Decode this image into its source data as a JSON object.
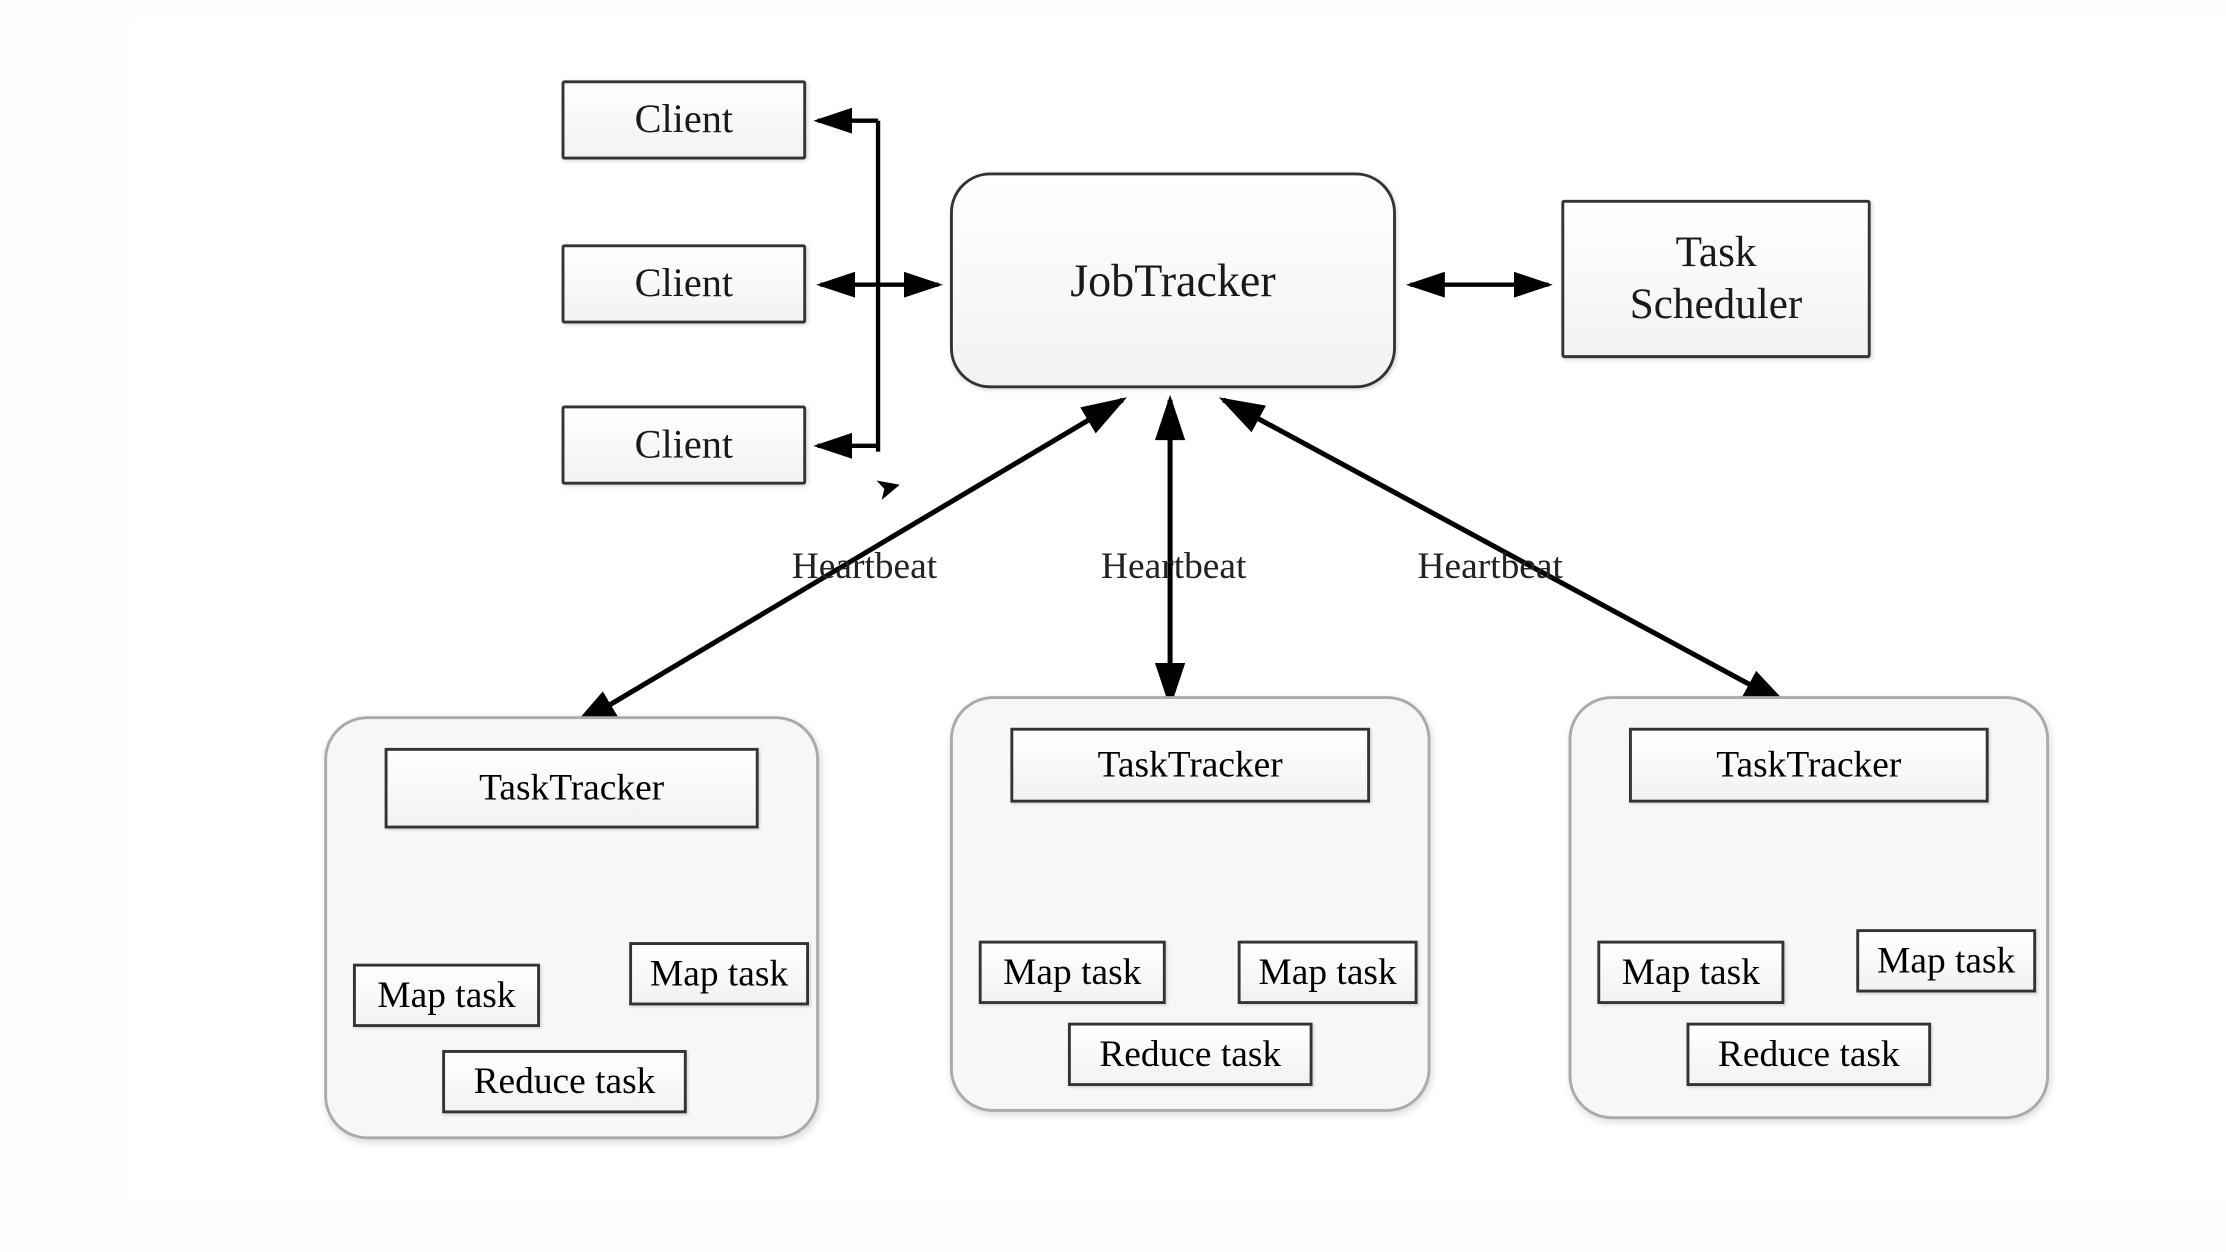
{
  "clients": [
    "Client",
    "Client",
    "Client"
  ],
  "jobtracker": "JobTracker",
  "scheduler_line1": "Task",
  "scheduler_line2": "Scheduler",
  "heartbeat": "Heartbeat",
  "tasktrackers": [
    {
      "title": "TaskTracker",
      "map_left": "Map task",
      "map_right": "Map task",
      "reduce": "Reduce task"
    },
    {
      "title": "TaskTracker",
      "map_left": "Map task",
      "map_right": "Map task",
      "reduce": "Reduce task"
    },
    {
      "title": "TaskTracker",
      "map_left": "Map task",
      "map_right": "Map task",
      "reduce": "Reduce task"
    }
  ]
}
